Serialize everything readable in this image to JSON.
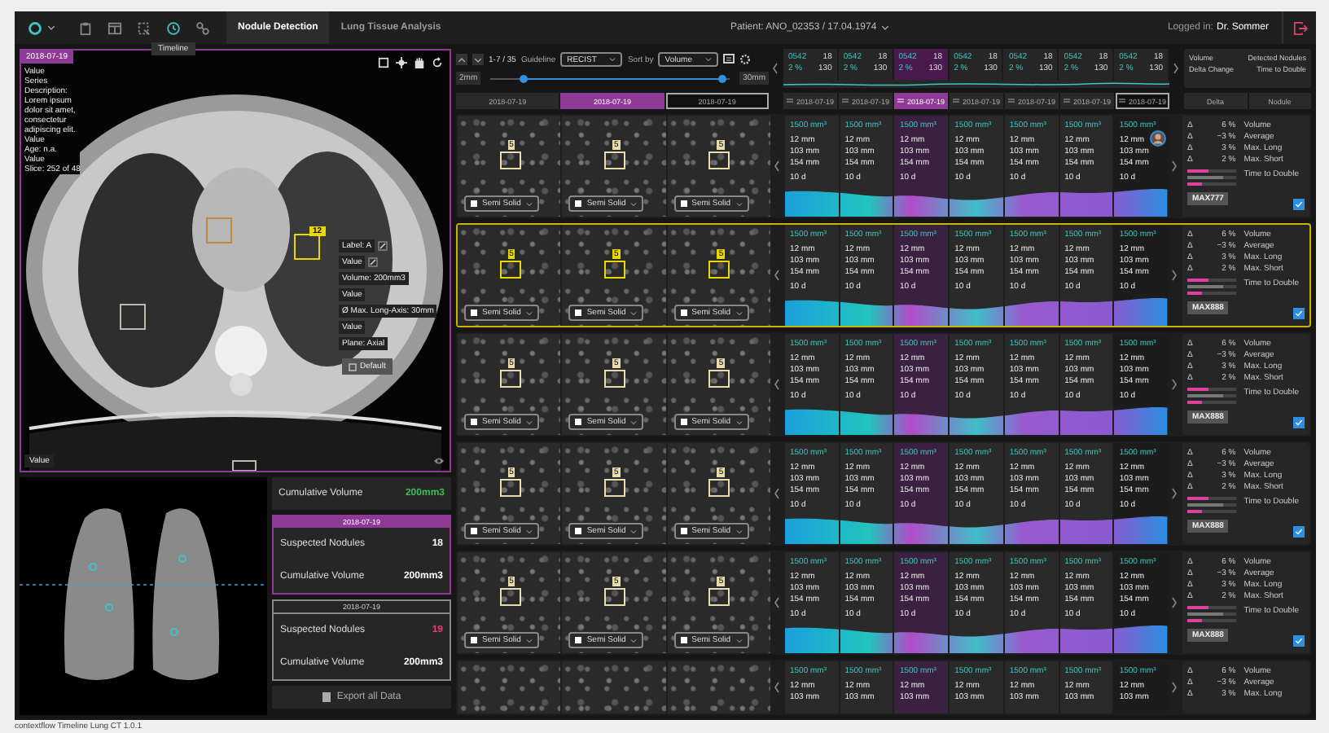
{
  "top_bar": {
    "tools": [
      {
        "kind": "clipboard",
        "selected": false
      },
      {
        "kind": "panel",
        "selected": false
      },
      {
        "kind": "image",
        "selected": false
      },
      {
        "kind": "timeline",
        "selected": true
      },
      {
        "kind": "nodes",
        "selected": false
      }
    ],
    "tooltip": "Timeline",
    "tabs": [
      {
        "label": "Nodule Detection",
        "selected": true
      },
      {
        "label": "Lung Tissue Analysis",
        "selected": false
      }
    ],
    "patient": "Patient: ANO_02353 / 17.04.1974",
    "user_label": "Logged in:",
    "user": "Dr. Sommer"
  },
  "viewer": {
    "date": "2018-07-19",
    "info": [
      "Value",
      "Series",
      "Description:",
      "Lorem ipsum",
      "dolor sit amet,",
      "consectetur",
      "adipiscing elit.",
      "Value",
      "Age: n.a.",
      "Value",
      "Slice: 252 of 48"
    ],
    "nodule_badge": "12",
    "annotation": [
      {
        "text": "Label: A",
        "kind": "editable"
      },
      {
        "text": "Value",
        "kind": "editable"
      },
      {
        "text": "Volume: 200mm3",
        "kind": "info"
      },
      {
        "text": "Value",
        "kind": "info"
      },
      {
        "text": "Ø Max. Long-Axis: 30mm",
        "kind": "info"
      },
      {
        "text": "Value",
        "kind": "info"
      },
      {
        "text": "Plane: Axial",
        "kind": "info"
      }
    ],
    "default_button": "Default",
    "corner_label": "Value"
  },
  "summary": {
    "current": {
      "label": "Cumulative Volume",
      "value": "200mm3"
    },
    "cards": [
      {
        "date": "2018-07-19",
        "selected": true,
        "nodules_label": "Suspected Nodules",
        "nodules": "18",
        "alert": false,
        "volume_label": "Cumulative Volume",
        "volume": "200mm3"
      },
      {
        "date": "2018-07-19",
        "selected": false,
        "nodules_label": "Suspected Nodules",
        "nodules": "19",
        "alert": true,
        "volume_label": "Cumulative Volume",
        "volume": "200mm3"
      }
    ],
    "export_button": "Export all Data"
  },
  "footer": "contextflow Timeline Lung CT 1.0.1",
  "controls": {
    "range": "1-7 / 35",
    "guideline_label": "Guideline",
    "guideline": "RECIST",
    "sort_label": "Sort by",
    "sort": "Volume",
    "slider_min": "2mm",
    "slider_max": "30mm",
    "slider": {
      "thumbs": [
        {
          "level": 0.14
        },
        {
          "level": 0.97
        }
      ]
    }
  },
  "thumb_dates": [
    {
      "date": "2018-07-19",
      "selected": false,
      "pinned": false
    },
    {
      "date": "2018-07-19",
      "selected": true,
      "pinned": false
    },
    {
      "date": "2018-07-19",
      "selected": false,
      "pinned": true
    }
  ],
  "timeline": {
    "cells": [
      {
        "code": "0542",
        "count": "18",
        "change": "2 %",
        "total": "130"
      },
      {
        "code": "0542",
        "count": "18",
        "change": "2 %",
        "total": "130"
      },
      {
        "code": "0542",
        "count": "18",
        "change": "2 %",
        "total": "130"
      },
      {
        "code": "0542",
        "count": "18",
        "change": "2 %",
        "total": "130"
      },
      {
        "code": "0542",
        "count": "18",
        "change": "2 %",
        "total": "130"
      },
      {
        "code": "0542",
        "count": "18",
        "change": "2 %",
        "total": "130"
      },
      {
        "code": "0542",
        "count": "18",
        "change": "2 %",
        "total": "130"
      }
    ],
    "dates": [
      {
        "date": "2018-07-19",
        "selected": false,
        "pinned": false
      },
      {
        "date": "2018-07-19",
        "selected": false,
        "pinned": false
      },
      {
        "date": "2018-07-19",
        "selected": true,
        "pinned": false
      },
      {
        "date": "2018-07-19",
        "selected": false,
        "pinned": false
      },
      {
        "date": "2018-07-19",
        "selected": false,
        "pinned": false
      },
      {
        "date": "2018-07-19",
        "selected": false,
        "pinned": false
      },
      {
        "date": "2018-07-19",
        "selected": false,
        "pinned": true
      }
    ]
  },
  "delta_header": {
    "left": [
      "Volume",
      "Delta Change"
    ],
    "right": [
      "Detected Nodules",
      "Time to Double"
    ]
  },
  "delta_tabs": [
    "Delta",
    "Nodule"
  ],
  "nodules": [
    {
      "selected": false,
      "avatar": true,
      "thumbs": [
        {
          "badge": "5",
          "type": "Semi Solid",
          "checked": false
        },
        {
          "badge": "5",
          "type": "Semi Solid",
          "checked": false
        },
        {
          "badge": "5",
          "type": "Semi Solid",
          "checked": false
        }
      ],
      "columns": [
        [
          "1500 mm³",
          "12 mm",
          "103 mm",
          "154 mm",
          "10 d"
        ],
        [
          "1500 mm³",
          "12 mm",
          "103 mm",
          "154 mm",
          "10 d"
        ],
        [
          "1500 mm³",
          "12 mm",
          "103 mm",
          "154 mm",
          "10 d"
        ],
        [
          "1500 mm³",
          "12 mm",
          "103 mm",
          "154 mm",
          "10 d"
        ],
        [
          "1500 mm³",
          "12 mm",
          "103 mm",
          "154 mm",
          "10 d"
        ],
        [
          "1500 mm³",
          "12 mm",
          "103 mm",
          "154 mm",
          "10 d"
        ],
        [
          "1500 mm³",
          "12 mm",
          "103 mm",
          "154 mm",
          "10 d"
        ]
      ],
      "deltas": [
        {
          "sign": "Δ",
          "value": "6 %",
          "label": "Volume"
        },
        {
          "sign": "Δ",
          "value": "−3 %",
          "label": "Average"
        },
        {
          "sign": "Δ",
          "value": "3 %",
          "label": "Max. Long"
        },
        {
          "sign": "Δ",
          "value": "2 %",
          "label": "Max. Short"
        }
      ],
      "time_label": "Time to Double",
      "bars": [
        {
          "level": 0.45,
          "color": "#e040a0"
        },
        {
          "level": 0.75,
          "color": "#777777"
        },
        {
          "level": 0.3,
          "color": "#e040a0"
        }
      ],
      "button": "MAX777",
      "checked": true
    },
    {
      "selected": true,
      "avatar": false,
      "thumbs": [
        {
          "badge": "5",
          "type": "Semi Solid",
          "checked": false
        },
        {
          "badge": "5",
          "type": "Semi Solid",
          "checked": false
        },
        {
          "badge": "5",
          "type": "Semi Solid",
          "checked": false
        }
      ],
      "columns": [
        [
          "1500 mm³",
          "12 mm",
          "103 mm",
          "154 mm",
          "10 d"
        ],
        [
          "1500 mm³",
          "12 mm",
          "103 mm",
          "154 mm",
          "10 d"
        ],
        [
          "1500 mm³",
          "12 mm",
          "103 mm",
          "154 mm",
          "10 d"
        ],
        [
          "1500 mm³",
          "12 mm",
          "103 mm",
          "154 mm",
          "10 d"
        ],
        [
          "1500 mm³",
          "12 mm",
          "103 mm",
          "154 mm",
          "10 d"
        ],
        [
          "1500 mm³",
          "12 mm",
          "103 mm",
          "154 mm",
          "10 d"
        ],
        [
          "1500 mm³",
          "12 mm",
          "103 mm",
          "154 mm",
          "10 d"
        ]
      ],
      "deltas": [
        {
          "sign": "Δ",
          "value": "6 %",
          "label": "Volume"
        },
        {
          "sign": "Δ",
          "value": "−3 %",
          "label": "Average"
        },
        {
          "sign": "Δ",
          "value": "3 %",
          "label": "Max. Long"
        },
        {
          "sign": "Δ",
          "value": "2 %",
          "label": "Max. Short"
        }
      ],
      "time_label": "Time to Double",
      "bars": [
        {
          "level": 0.45,
          "color": "#e040a0"
        },
        {
          "level": 0.75,
          "color": "#777777"
        },
        {
          "level": 0.3,
          "color": "#e040a0"
        }
      ],
      "button": "MAX888",
      "checked": true
    },
    {
      "selected": false,
      "avatar": false,
      "thumbs": [
        {
          "badge": "5",
          "type": "Semi Solid",
          "checked": false
        },
        {
          "badge": "5",
          "type": "Semi Solid",
          "checked": false
        },
        {
          "badge": "5",
          "type": "Semi Solid",
          "checked": false
        }
      ],
      "columns": [
        [
          "1500 mm³",
          "12 mm",
          "103 mm",
          "154 mm",
          "10 d"
        ],
        [
          "1500 mm³",
          "12 mm",
          "103 mm",
          "154 mm",
          "10 d"
        ],
        [
          "1500 mm³",
          "12 mm",
          "103 mm",
          "154 mm",
          "10 d"
        ],
        [
          "1500 mm³",
          "12 mm",
          "103 mm",
          "154 mm",
          "10 d"
        ],
        [
          "1500 mm³",
          "12 mm",
          "103 mm",
          "154 mm",
          "10 d"
        ],
        [
          "1500 mm³",
          "12 mm",
          "103 mm",
          "154 mm",
          "10 d"
        ],
        [
          "1500 mm³",
          "12 mm",
          "103 mm",
          "154 mm",
          "10 d"
        ]
      ],
      "deltas": [
        {
          "sign": "Δ",
          "value": "6 %",
          "label": "Volume"
        },
        {
          "sign": "Δ",
          "value": "−3 %",
          "label": "Average"
        },
        {
          "sign": "Δ",
          "value": "3 %",
          "label": "Max. Long"
        },
        {
          "sign": "Δ",
          "value": "2 %",
          "label": "Max. Short"
        }
      ],
      "time_label": "Time to Double",
      "bars": [
        {
          "level": 0.45,
          "color": "#e040a0"
        },
        {
          "level": 0.75,
          "color": "#777777"
        },
        {
          "level": 0.3,
          "color": "#e040a0"
        }
      ],
      "button": "MAX888",
      "checked": true
    },
    {
      "selected": false,
      "avatar": false,
      "thumbs": [
        {
          "badge": "5",
          "type": "Semi Solid",
          "checked": false
        },
        {
          "badge": "5",
          "type": "Semi Solid",
          "checked": false
        },
        {
          "badge": "5",
          "type": "Semi Solid",
          "checked": false
        }
      ],
      "columns": [
        [
          "1500 mm³",
          "12 mm",
          "103 mm",
          "154 mm",
          "10 d"
        ],
        [
          "1500 mm³",
          "12 mm",
          "103 mm",
          "154 mm",
          "10 d"
        ],
        [
          "1500 mm³",
          "12 mm",
          "103 mm",
          "154 mm",
          "10 d"
        ],
        [
          "1500 mm³",
          "12 mm",
          "103 mm",
          "154 mm",
          "10 d"
        ],
        [
          "1500 mm³",
          "12 mm",
          "103 mm",
          "154 mm",
          "10 d"
        ],
        [
          "1500 mm³",
          "12 mm",
          "103 mm",
          "154 mm",
          "10 d"
        ],
        [
          "1500 mm³",
          "12 mm",
          "103 mm",
          "154 mm",
          "10 d"
        ]
      ],
      "deltas": [
        {
          "sign": "Δ",
          "value": "6 %",
          "label": "Volume"
        },
        {
          "sign": "Δ",
          "value": "−3 %",
          "label": "Average"
        },
        {
          "sign": "Δ",
          "value": "3 %",
          "label": "Max. Long"
        },
        {
          "sign": "Δ",
          "value": "2 %",
          "label": "Max. Short"
        }
      ],
      "time_label": "Time to Double",
      "bars": [
        {
          "level": 0.45,
          "color": "#e040a0"
        },
        {
          "level": 0.75,
          "color": "#777777"
        },
        {
          "level": 0.3,
          "color": "#e040a0"
        }
      ],
      "button": "MAX888",
      "checked": true
    },
    {
      "selected": false,
      "avatar": false,
      "thumbs": [
        {
          "badge": "5",
          "type": "Semi Solid",
          "checked": false
        },
        {
          "badge": "5",
          "type": "Semi Solid",
          "checked": false
        },
        {
          "badge": "5",
          "type": "Semi Solid",
          "checked": false
        }
      ],
      "columns": [
        [
          "1500 mm³",
          "12 mm",
          "103 mm",
          "154 mm",
          "10 d"
        ],
        [
          "1500 mm³",
          "12 mm",
          "103 mm",
          "154 mm",
          "10 d"
        ],
        [
          "1500 mm³",
          "12 mm",
          "103 mm",
          "154 mm",
          "10 d"
        ],
        [
          "1500 mm³",
          "12 mm",
          "103 mm",
          "154 mm",
          "10 d"
        ],
        [
          "1500 mm³",
          "12 mm",
          "103 mm",
          "154 mm",
          "10 d"
        ],
        [
          "1500 mm³",
          "12 mm",
          "103 mm",
          "154 mm",
          "10 d"
        ],
        [
          "1500 mm³",
          "12 mm",
          "103 mm",
          "154 mm",
          "10 d"
        ]
      ],
      "deltas": [
        {
          "sign": "Δ",
          "value": "6 %",
          "label": "Volume"
        },
        {
          "sign": "Δ",
          "value": "−3 %",
          "label": "Average"
        },
        {
          "sign": "Δ",
          "value": "3 %",
          "label": "Max. Long"
        },
        {
          "sign": "Δ",
          "value": "2 %",
          "label": "Max. Short"
        }
      ],
      "time_label": "Time to Double",
      "bars": [
        {
          "level": 0.45,
          "color": "#e040a0"
        },
        {
          "level": 0.75,
          "color": "#777777"
        },
        {
          "level": 0.3,
          "color": "#e040a0"
        }
      ],
      "button": "MAX888",
      "checked": true
    },
    {
      "selected": false,
      "columns": [
        [
          "1500 mm³",
          "12 mm",
          "103 mm"
        ],
        [
          "1500 mm³",
          "12 mm",
          "103 mm"
        ],
        [
          "1500 mm³",
          "12 mm",
          "103 mm"
        ],
        [
          "1500 mm³",
          "12 mm",
          "103 mm"
        ],
        [
          "1500 mm³",
          "12 mm",
          "103 mm"
        ],
        [
          "1500 mm³",
          "12 mm",
          "103 mm"
        ],
        [
          "1500 mm³",
          "12 mm",
          "103 mm"
        ]
      ],
      "deltas": [
        {
          "sign": "Δ",
          "value": "6 %",
          "label": "Volume"
        },
        {
          "sign": "Δ",
          "value": "−3 %",
          "label": "Average"
        },
        {
          "sign": "Δ",
          "value": "3 %",
          "label": "Max. Long"
        }
      ]
    }
  ]
}
